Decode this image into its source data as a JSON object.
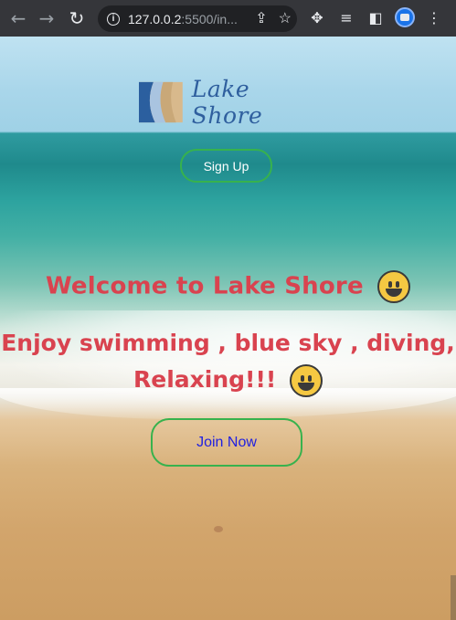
{
  "browser": {
    "url_host": "127.0.0.2",
    "url_rest": ":5500/in...",
    "icons": [
      "back-icon",
      "forward-icon",
      "reload-icon",
      "info-icon",
      "share-icon",
      "star-icon",
      "extensions-icon",
      "media-icon",
      "sidepanel-icon",
      "profile-avatar"
    ]
  },
  "page": {
    "brand": "Lake Shore",
    "signup_label": "Sign Up",
    "welcome": "Welcome to Lake Shore",
    "enjoy_line1": "Enjoy swimming , blue sky , diving,",
    "enjoy_line2": "Relaxing!!!",
    "join_label": "Join Now",
    "accent_text_color": "#d9434f",
    "button_border_color": "#37b24d"
  }
}
